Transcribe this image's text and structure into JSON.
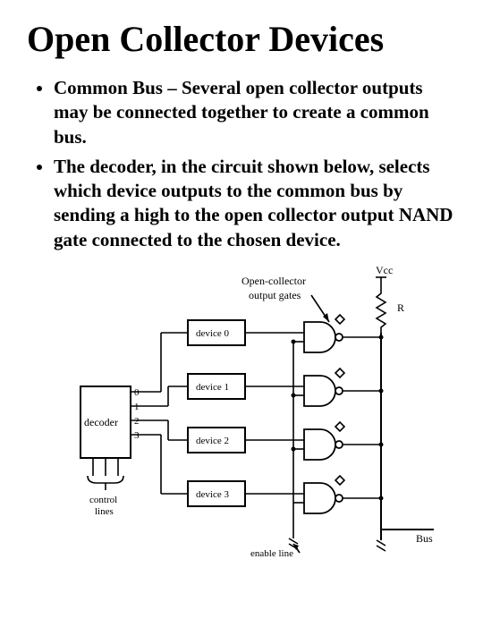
{
  "title": "Open Collector Devices",
  "bullets": [
    "Common Bus – Several open collector outputs may be connected together to create a common bus.",
    "The decoder, in the circuit shown below, selects which device outputs to the common bus by sending a high to the open collector output NAND gate connected to the chosen device."
  ],
  "diagram": {
    "vcc": "Vcc",
    "r": "R",
    "oc_label1": "Open-collector",
    "oc_label2": "output gates",
    "decoder": "decoder",
    "devices": [
      "device 0",
      "device 1",
      "device 2",
      "device 3"
    ],
    "dec_nums": [
      "0",
      "1",
      "2",
      "3"
    ],
    "control": "control",
    "lines": "lines",
    "enable": "enable line",
    "bus": "Bus"
  }
}
